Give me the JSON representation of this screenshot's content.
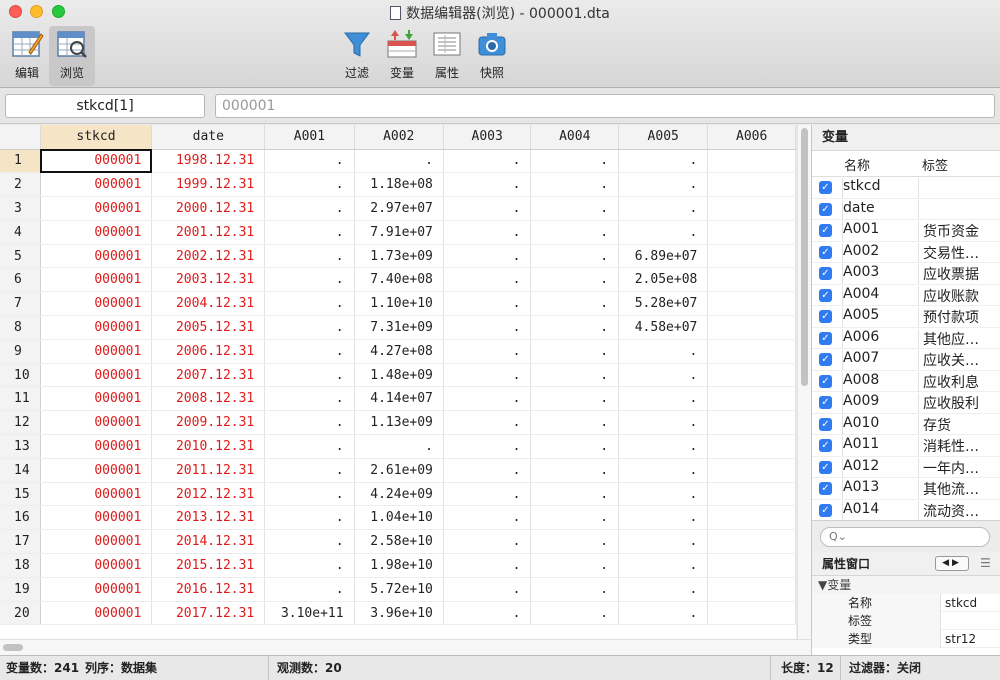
{
  "window": {
    "title": "数据编辑器(浏览) - 000001.dta"
  },
  "toolbar": {
    "edit": "编辑",
    "browse": "浏览",
    "filter": "过滤",
    "variables": "变量",
    "properties": "属性",
    "snapshot": "快照"
  },
  "cellbar": {
    "name": "stkcd[1]",
    "value": "000001"
  },
  "grid": {
    "columns": [
      "stkcd",
      "date",
      "A001",
      "A002",
      "A003",
      "A004",
      "A005",
      "A006"
    ],
    "rows": [
      [
        "1",
        "000001",
        "1998.12.31",
        ".",
        ".",
        ".",
        ".",
        ".",
        ""
      ],
      [
        "2",
        "000001",
        "1999.12.31",
        ".",
        "1.18e+08",
        ".",
        ".",
        ".",
        ""
      ],
      [
        "3",
        "000001",
        "2000.12.31",
        ".",
        "2.97e+07",
        ".",
        ".",
        ".",
        ""
      ],
      [
        "4",
        "000001",
        "2001.12.31",
        ".",
        "7.91e+07",
        ".",
        ".",
        ".",
        ""
      ],
      [
        "5",
        "000001",
        "2002.12.31",
        ".",
        "1.73e+09",
        ".",
        ".",
        "6.89e+07",
        ""
      ],
      [
        "6",
        "000001",
        "2003.12.31",
        ".",
        "7.40e+08",
        ".",
        ".",
        "2.05e+08",
        ""
      ],
      [
        "7",
        "000001",
        "2004.12.31",
        ".",
        "1.10e+10",
        ".",
        ".",
        "5.28e+07",
        ""
      ],
      [
        "8",
        "000001",
        "2005.12.31",
        ".",
        "7.31e+09",
        ".",
        ".",
        "4.58e+07",
        ""
      ],
      [
        "9",
        "000001",
        "2006.12.31",
        ".",
        "4.27e+08",
        ".",
        ".",
        ".",
        ""
      ],
      [
        "10",
        "000001",
        "2007.12.31",
        ".",
        "1.48e+09",
        ".",
        ".",
        ".",
        ""
      ],
      [
        "11",
        "000001",
        "2008.12.31",
        ".",
        "4.14e+07",
        ".",
        ".",
        ".",
        ""
      ],
      [
        "12",
        "000001",
        "2009.12.31",
        ".",
        "1.13e+09",
        ".",
        ".",
        ".",
        ""
      ],
      [
        "13",
        "000001",
        "2010.12.31",
        ".",
        ".",
        ".",
        ".",
        ".",
        ""
      ],
      [
        "14",
        "000001",
        "2011.12.31",
        ".",
        "2.61e+09",
        ".",
        ".",
        ".",
        ""
      ],
      [
        "15",
        "000001",
        "2012.12.31",
        ".",
        "4.24e+09",
        ".",
        ".",
        ".",
        ""
      ],
      [
        "16",
        "000001",
        "2013.12.31",
        ".",
        "1.04e+10",
        ".",
        ".",
        ".",
        ""
      ],
      [
        "17",
        "000001",
        "2014.12.31",
        ".",
        "2.58e+10",
        ".",
        ".",
        ".",
        ""
      ],
      [
        "18",
        "000001",
        "2015.12.31",
        ".",
        "1.98e+10",
        ".",
        ".",
        ".",
        ""
      ],
      [
        "19",
        "000001",
        "2016.12.31",
        ".",
        "5.72e+10",
        ".",
        ".",
        ".",
        ""
      ],
      [
        "20",
        "000001",
        "2017.12.31",
        "3.10e+11",
        "3.96e+10",
        ".",
        ".",
        ".",
        ""
      ]
    ]
  },
  "variables_panel": {
    "title": "变量",
    "col_name": "名称",
    "col_label": "标签",
    "search_icon": "search-icon",
    "items": [
      {
        "name": "stkcd",
        "label": ""
      },
      {
        "name": "date",
        "label": ""
      },
      {
        "name": "A001",
        "label": "货币资金"
      },
      {
        "name": "A002",
        "label": "交易性…"
      },
      {
        "name": "A003",
        "label": "应收票据"
      },
      {
        "name": "A004",
        "label": "应收账款"
      },
      {
        "name": "A005",
        "label": "预付款项"
      },
      {
        "name": "A006",
        "label": "其他应…"
      },
      {
        "name": "A007",
        "label": "应收关…"
      },
      {
        "name": "A008",
        "label": "应收利息"
      },
      {
        "name": "A009",
        "label": "应收股利"
      },
      {
        "name": "A010",
        "label": "存货"
      },
      {
        "name": "A011",
        "label": "消耗性…"
      },
      {
        "name": "A012",
        "label": "一年内…"
      },
      {
        "name": "A013",
        "label": "其他流…"
      },
      {
        "name": "A014",
        "label": "流动资…"
      }
    ]
  },
  "properties_panel": {
    "title": "属性窗口",
    "group": "▼变量",
    "rows": [
      {
        "key": "名称",
        "value": "stkcd"
      },
      {
        "key": "标签",
        "value": ""
      },
      {
        "key": "类型",
        "value": "str12"
      }
    ]
  },
  "status": {
    "vars": "变量数：241",
    "order": "列序：数据集",
    "obs": "观测数：20",
    "length": "长度：12",
    "filter": "过滤器：关闭"
  },
  "colors": {
    "string_text": "#e01b1b",
    "checkbox": "#2f7bef",
    "selected_header": "#f6e4c6"
  }
}
